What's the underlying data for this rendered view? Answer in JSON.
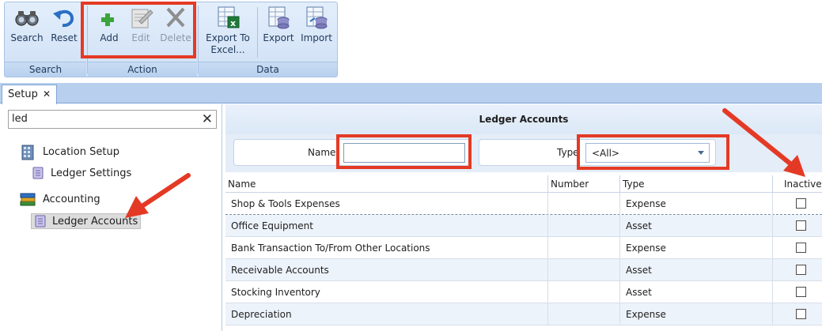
{
  "ribbon": {
    "buttons": {
      "search": "Search",
      "reset": "Reset",
      "add": "Add",
      "edit": "Edit",
      "delete": "Delete",
      "export_excel_1": "Export To",
      "export_excel_2": "Excel...",
      "export": "Export",
      "import": "Import"
    },
    "groups": {
      "search": "Search",
      "action": "Action",
      "data": "Data"
    }
  },
  "tabs": [
    {
      "label": "Setup"
    }
  ],
  "left": {
    "search_value": "led",
    "tree": [
      {
        "label": "Location Setup",
        "icon": "building-icon"
      },
      {
        "label": "Ledger Settings",
        "icon": "ledger-settings-icon"
      },
      {
        "label": "Accounting",
        "icon": "books-icon"
      },
      {
        "label": "Ledger Accounts",
        "icon": "ledger-accounts-icon",
        "selected": true
      }
    ]
  },
  "main": {
    "title": "Ledger Accounts",
    "filters": {
      "name_label": "Name",
      "name_value": "",
      "type_label": "Type",
      "type_value": "<All>"
    },
    "columns": [
      "Name",
      "Number",
      "Type",
      "Inactive"
    ],
    "rows": [
      {
        "name": "Shop & Tools Expenses",
        "number": "",
        "type": "Expense",
        "inactive": false
      },
      {
        "name": "Office Equipment",
        "number": "",
        "type": "Asset",
        "inactive": false
      },
      {
        "name": "Bank Transaction To/From Other Locations",
        "number": "",
        "type": "Expense",
        "inactive": false
      },
      {
        "name": "Receivable Accounts",
        "number": "",
        "type": "Asset",
        "inactive": false
      },
      {
        "name": "Stocking Inventory",
        "number": "",
        "type": "Asset",
        "inactive": false
      },
      {
        "name": "Depreciation",
        "number": "",
        "type": "Expense",
        "inactive": false
      }
    ]
  },
  "colors": {
    "highlight": "#e43a25",
    "ribbon_bg": "#d6e5f7",
    "row_alt": "#edf3fb"
  }
}
